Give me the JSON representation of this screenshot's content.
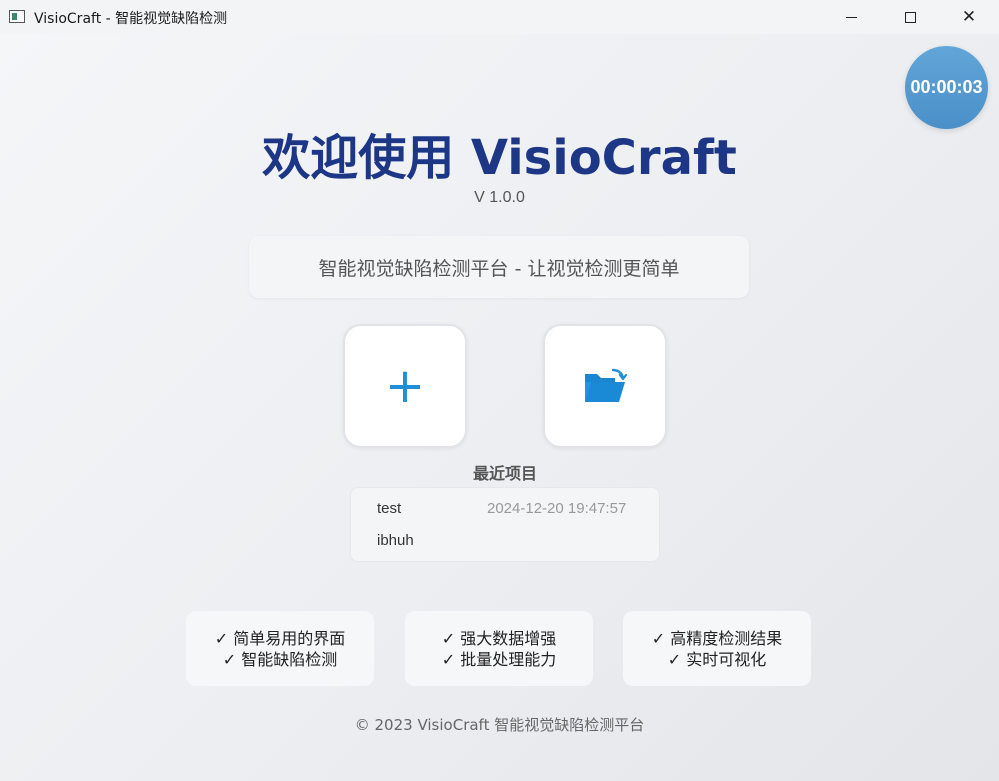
{
  "window": {
    "title": "VisioCraft - 智能视觉缺陷检测",
    "close_glyph": "✕"
  },
  "timer": {
    "value": "00:00:03"
  },
  "header": {
    "welcome": "欢迎使用 VisioCraft",
    "version": "V 1.0.0",
    "subtitle": "智能视觉缺陷检测平台 - 让视觉检测更简单"
  },
  "actions": {
    "new_project_icon": "plus-icon",
    "new_project_glyph": "+",
    "open_project_icon": "folder-open-icon",
    "accent_color": "#1f8fd6"
  },
  "recent": {
    "title": "最近项目",
    "items": [
      {
        "name": "test",
        "time": "2024-12-20 19:47:57"
      },
      {
        "name": "ibhuh",
        "time": ""
      }
    ]
  },
  "features": [
    {
      "line1": "✓ 简单易用的界面",
      "line2": "✓ 智能缺陷检测"
    },
    {
      "line1": "✓ 强大数据增强",
      "line2": "✓ 批量处理能力"
    },
    {
      "line1": "✓ 高精度检测结果",
      "line2": "✓ 实时可视化"
    }
  ],
  "footer": {
    "text": "© 2023 VisioCraft 智能视觉缺陷检测平台"
  },
  "colors": {
    "title_blue": "#1d3786",
    "timer_blue": "#4a8fc8"
  }
}
